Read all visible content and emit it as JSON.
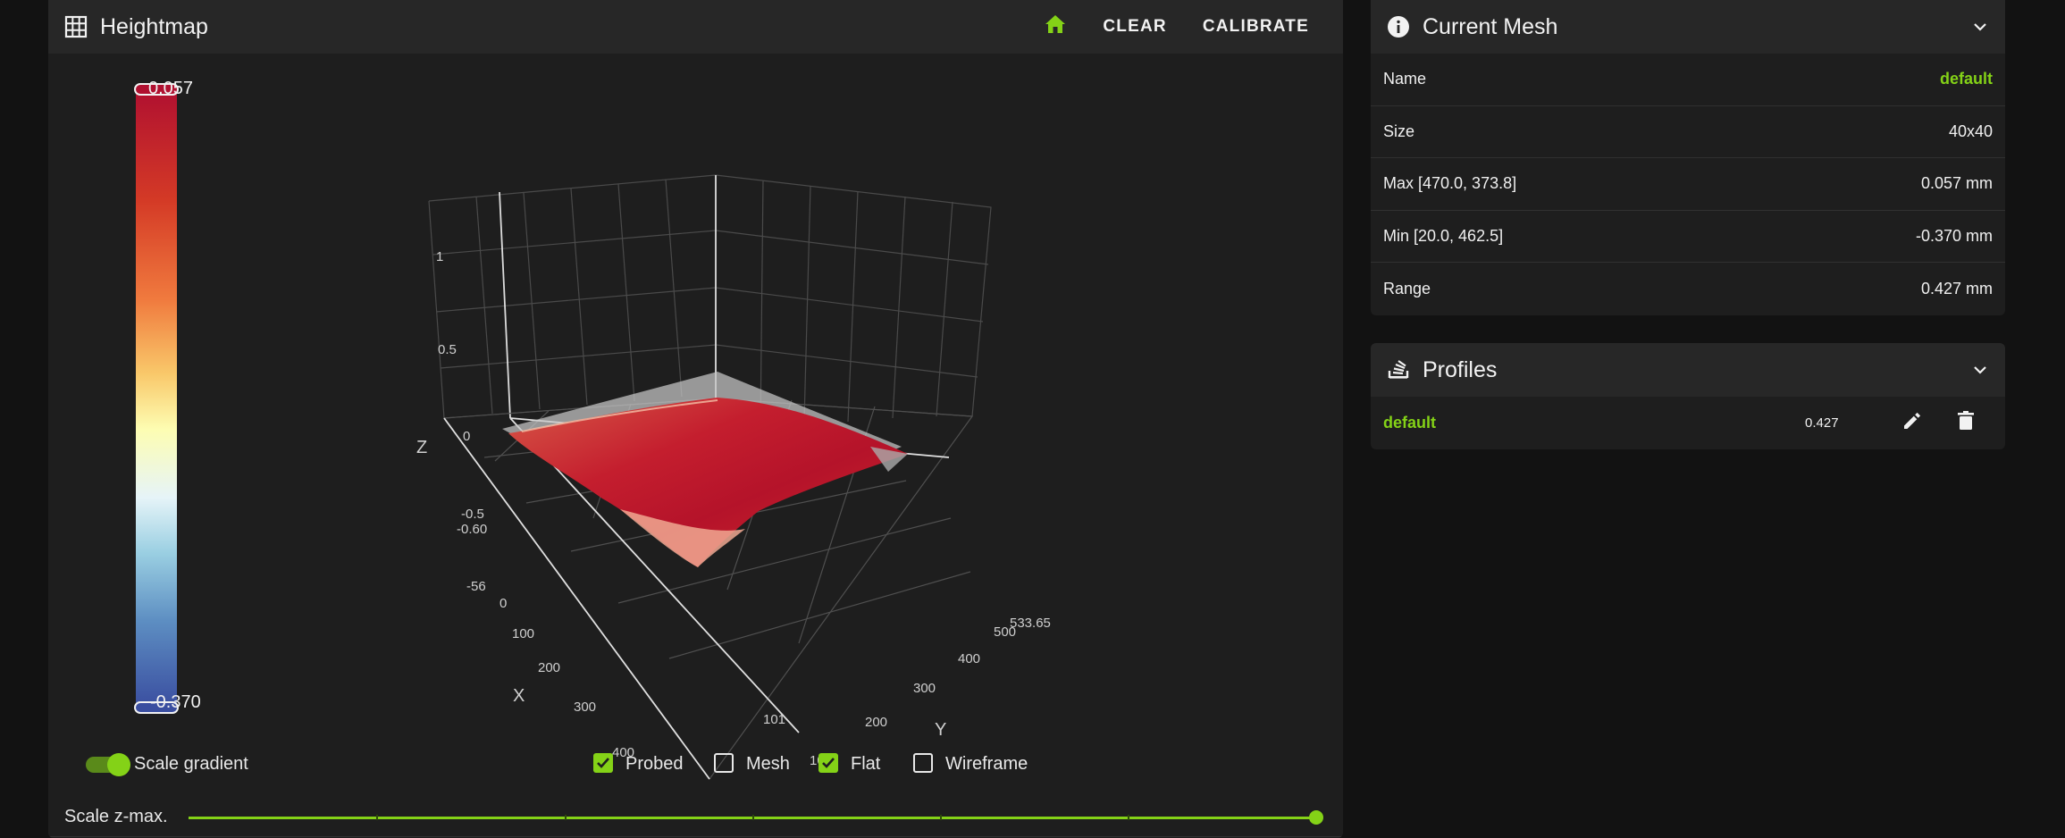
{
  "heightmap": {
    "title": "Heightmap",
    "home_icon": "home-icon",
    "clear_label": "CLEAR",
    "calibrate_label": "CALIBRATE",
    "gradient_max": "0.057",
    "gradient_min": "-0.370",
    "z_axis_title": "Z",
    "x_axis_title": "X",
    "y_axis_title": "Y",
    "z_ticks": [
      "1",
      "0.5",
      "0",
      "-0.5"
    ],
    "x_ticks": [
      "0",
      "100",
      "200",
      "300",
      "400"
    ],
    "y_ticks": [
      "100",
      "200",
      "300",
      "400",
      "500"
    ],
    "z_floor_label": "-0.60",
    "x_origin_label": "-56",
    "y_end_label": "533.65",
    "x_hover_label": "101",
    "scale_gradient_label": "Scale gradient",
    "scale_gradient_on": true,
    "layers": [
      {
        "label": "Probed",
        "checked": true
      },
      {
        "label": "Mesh",
        "checked": false
      },
      {
        "label": "Flat",
        "checked": true
      },
      {
        "label": "Wireframe",
        "checked": false
      }
    ],
    "scale_zmax_label": "Scale z-max.",
    "scale_zmax_value": 1.0,
    "colors": {
      "accent": "#84d217",
      "surface_high": "#b01030",
      "surface_low": "#3a4ea0"
    }
  },
  "current_mesh": {
    "title": "Current Mesh",
    "rows": [
      {
        "key": "Name",
        "value": "default",
        "accent": true
      },
      {
        "key": "Size",
        "value": "40x40",
        "accent": false
      },
      {
        "key": "Max [470.0, 373.8]",
        "value": "0.057 mm",
        "accent": false
      },
      {
        "key": "Min [20.0, 462.5]",
        "value": "-0.370 mm",
        "accent": false
      },
      {
        "key": "Range",
        "value": "0.427 mm",
        "accent": false
      }
    ]
  },
  "profiles": {
    "title": "Profiles",
    "items": [
      {
        "name": "default",
        "range": "0.427",
        "edit_icon": "pencil-icon",
        "delete_icon": "trash-icon"
      }
    ]
  }
}
